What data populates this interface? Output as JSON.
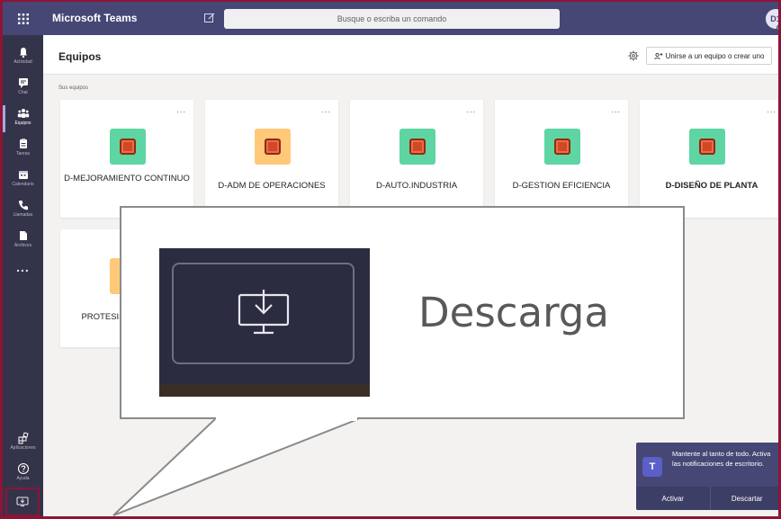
{
  "app": {
    "title": "Microsoft Teams",
    "user_initials": "D1"
  },
  "search": {
    "placeholder": "Busque o escriba un comando"
  },
  "rail": {
    "items": [
      {
        "label": "Actividad",
        "icon": "bell-icon"
      },
      {
        "label": "Chat",
        "icon": "chat-icon"
      },
      {
        "label": "Equipos",
        "icon": "teams-icon",
        "active": true
      },
      {
        "label": "Tareas",
        "icon": "tasks-icon"
      },
      {
        "label": "Calendario",
        "icon": "calendar-icon"
      },
      {
        "label": "Llamadas",
        "icon": "phone-icon"
      },
      {
        "label": "Archivos",
        "icon": "files-icon"
      }
    ],
    "more": "...",
    "bottom": [
      {
        "label": "Aplicaciones",
        "icon": "apps-icon"
      },
      {
        "label": "Ayuda",
        "icon": "help-icon"
      }
    ]
  },
  "header": {
    "title": "Equipos",
    "join_button": "Unirse a un equipo o crear uno"
  },
  "section_label": "Sus equipos",
  "teams": [
    {
      "name": "D-MEJORAMIENTO CONTINUO",
      "tile_color": "#5ed5a3"
    },
    {
      "name": "D-ADM DE OPERACIONES",
      "tile_color": "#ffc979"
    },
    {
      "name": "D-AUTO.INDUSTRIA",
      "tile_color": "#5ed5a3"
    },
    {
      "name": "D-GESTION EFICIENCIA",
      "tile_color": "#5ed5a3"
    },
    {
      "name": "D-DISEÑO DE PLANTA",
      "tile_color": "#5ed5a3"
    },
    {
      "name": "PROTESIS",
      "tile_color": "#ffc979"
    }
  ],
  "card_menu": "...",
  "callout": {
    "text": "Descarga"
  },
  "toast": {
    "message": "Mantente al tanto de todo. Activa las notificaciones de escritorio.",
    "activate": "Activar",
    "dismiss": "Descartar"
  },
  "colors": {
    "topbar": "#464775",
    "rail": "#33344a",
    "highlight": "#8e1436"
  }
}
